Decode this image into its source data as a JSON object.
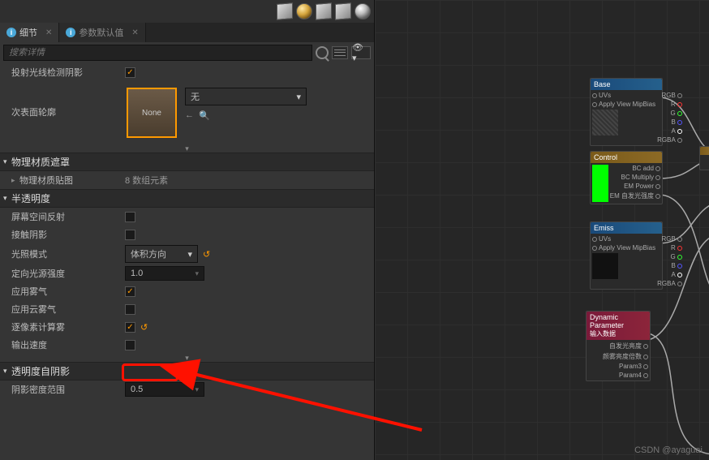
{
  "toolbar_top": {},
  "tabs": [
    {
      "label": "细节",
      "active": true
    },
    {
      "label": "参数默认值",
      "active": false
    }
  ],
  "search": {
    "placeholder": "搜索详情"
  },
  "rows": {
    "ray_shadow": "投射光线检测阴影",
    "subsurface": "次表面轮廓",
    "subsurface_none": "None",
    "subsurface_dd": "无"
  },
  "cat_phys": "物理材质遮罩",
  "phys_tex_label": "物理材质贴图",
  "phys_tex_value": "8 数组元素",
  "cat_trans": "半透明度",
  "trans": {
    "ssr": "屏幕空间反射",
    "contact": "接触阴影",
    "lightmode": "光照模式",
    "lightmode_val": "体积方向",
    "dirlight": "定向光源强度",
    "dirlight_val": "1.0",
    "fog": "应用雾气",
    "cloud_fog": "应用云雾气",
    "perpixel": "逐像素计算雾",
    "out_vel": "输出速度"
  },
  "cat_selfshadow": "透明度自阴影",
  "shadow_density": "阴影密度范围",
  "shadow_density_val": "0.5",
  "nodes": {
    "base": {
      "title": "Base",
      "pins_l": [
        "UVs",
        "Apply View MipBias"
      ],
      "pins_r": [
        "RGB",
        "R",
        "G",
        "B",
        "A",
        "RGBA"
      ]
    },
    "control": {
      "title": "Control",
      "pins_r": [
        "BC add",
        "BC Multiply",
        "EM Power",
        "EM 自发光强度"
      ]
    },
    "emiss": {
      "title": "Emiss",
      "pins_l": [
        "UVs",
        "Apply View MipBias"
      ],
      "pins_r": [
        "RGB",
        "R",
        "G",
        "B",
        "A",
        "RGBA"
      ]
    },
    "dynparam": {
      "title": "Dynamic Parameter",
      "sub": "输入数据",
      "pins_r": [
        "自发光亮度",
        "颜雾亮度倍数",
        "Param3",
        "Param4"
      ]
    }
  },
  "watermark": "CSDN @ayaguai"
}
